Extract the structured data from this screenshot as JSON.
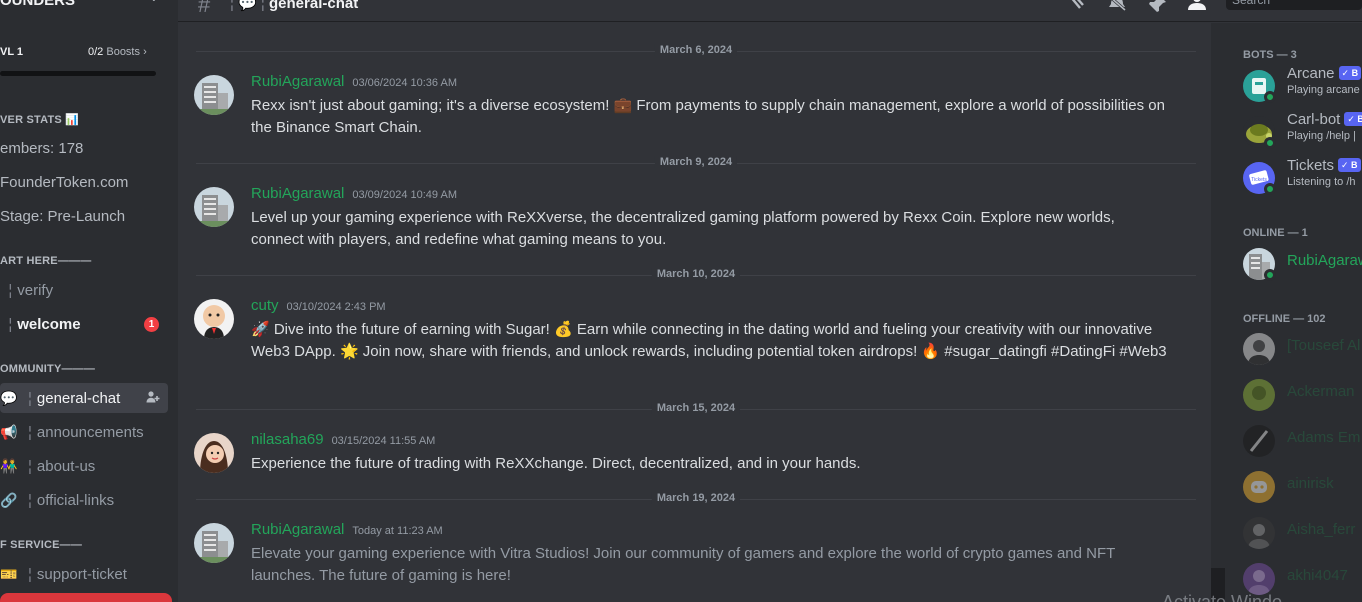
{
  "server": {
    "name": "OUNDERS",
    "level": "VL 1",
    "boosts_count": "0/2",
    "boosts_label": "Boosts"
  },
  "sidebar": {
    "stats_category": "VER STATS 📊",
    "stats": [
      "embers: 178",
      "FounderToken.com",
      "Stage: Pre-Launch"
    ],
    "start_category": "ART HERE———",
    "start_channels": [
      {
        "emoji": "",
        "name": "verify"
      },
      {
        "emoji": "",
        "name": "welcome",
        "badge": "1"
      }
    ],
    "community_category": "OMMUNITY———",
    "community_channels": [
      {
        "emoji": "💬",
        "name": "general-chat"
      },
      {
        "emoji": "📢",
        "name": "announcements"
      },
      {
        "emoji": "👫",
        "name": "about-us"
      },
      {
        "emoji": "🔗",
        "name": "official-links"
      }
    ],
    "service_category": "F SERVICE——",
    "service_channels": [
      {
        "emoji": "🎫",
        "name": "support-ticket"
      }
    ]
  },
  "header": {
    "channel_emoji": "💬",
    "channel_name": "general-chat",
    "search_placeholder": "Search"
  },
  "messages": [
    {
      "date": "March 6, 2024",
      "author": "RubiAgarawal",
      "timestamp": "03/06/2024 10:36 AM",
      "text": "Rexx isn't just about gaming; it's a diverse ecosystem! 💼 From payments to supply chain management, explore a world of possibilities on the Binance Smart Chain."
    },
    {
      "date": "March 9, 2024",
      "author": "RubiAgarawal",
      "timestamp": "03/09/2024 10:49 AM",
      "text": "Level up your gaming experience with ReXXverse, the decentralized gaming platform powered by Rexx Coin. Explore new worlds, connect with players, and redefine what gaming means to you."
    },
    {
      "date": "March 10, 2024",
      "author": "cuty",
      "timestamp": "03/10/2024 2:43 PM",
      "text": "🚀 Dive into the future of earning with Sugar! 💰 Earn while connecting in the dating world and fueling your creativity with our innovative Web3 DApp. 🌟 Join now, share with friends, and unlock rewards, including potential token airdrops! 🔥 #sugar_datingfi #DatingFi #Web3"
    },
    {
      "date": "March 15, 2024",
      "author": "nilasaha69",
      "timestamp": "03/15/2024 11:55 AM",
      "text": "Experience the future of trading with ReXXchange. Direct, decentralized, and in your hands."
    },
    {
      "date": "March 19, 2024",
      "author": "RubiAgarawal",
      "timestamp": "Today at 11:23 AM",
      "text": "Elevate your gaming experience with Vitra Studios! Join our community of gamers and explore the world of crypto games and NFT launches. The future of gaming is here!"
    }
  ],
  "members": {
    "bots_header": "BOTS — 3",
    "bots": [
      {
        "name": "Arcane",
        "badge": "B",
        "status": "Playing arcane"
      },
      {
        "name": "Carl-bot",
        "badge": "B",
        "status": "Playing /help |"
      },
      {
        "name": "Tickets",
        "badge": "B",
        "status": "Listening to /h"
      }
    ],
    "online_header": "ONLINE — 1",
    "online": [
      {
        "name": "RubiAgarawa"
      }
    ],
    "offline_header": "OFFLINE — 102",
    "offline": [
      {
        "name": "[Touseef Al"
      },
      {
        "name": "Ackerman"
      },
      {
        "name": "Adams Em"
      },
      {
        "name": "ainirisk"
      },
      {
        "name": "Aisha_ferr"
      },
      {
        "name": "akhi4047"
      }
    ]
  },
  "watermark": "Activate Windo"
}
